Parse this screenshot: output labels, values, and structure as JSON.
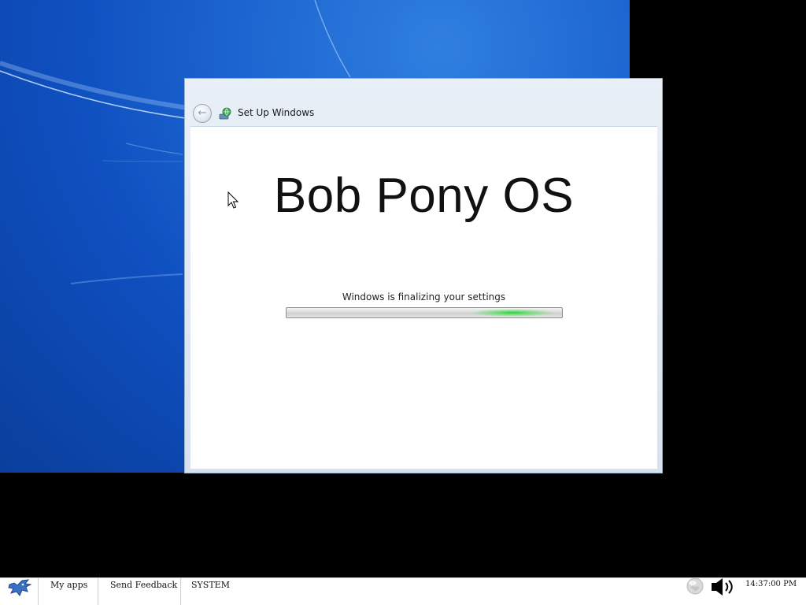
{
  "desktop": {
    "wallpaper_color": "#1b63cf"
  },
  "setup_window": {
    "title": "Set Up Windows",
    "back_icon": "back-arrow-icon",
    "title_icon": "setup-globe-icon",
    "brand_heading": "Bob Pony OS",
    "status_text": "Windows is finalizing your settings",
    "progress": {
      "style": "marquee",
      "glow_color": "#28d23c",
      "glow_position_fraction": 0.82
    }
  },
  "taskbar": {
    "start_icon": "bob-pony-logo-icon",
    "items": [
      {
        "label": "My apps"
      },
      {
        "label": "Send Feedback"
      },
      {
        "label": "SYSTEM"
      }
    ],
    "tray": {
      "network_icon": "globe-icon",
      "volume_icon": "speaker-icon"
    },
    "clock": "14:37:00 PM"
  }
}
